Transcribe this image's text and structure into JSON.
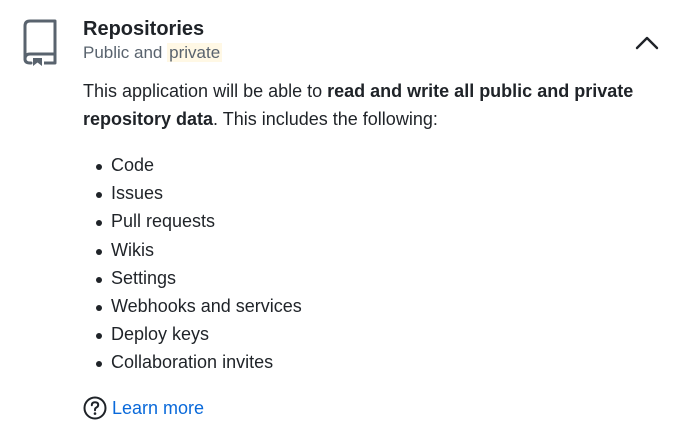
{
  "section": {
    "title": "Repositories",
    "subtitle_prefix": "Public and ",
    "subtitle_highlight": "private",
    "collapse_icon": "chevron-up-icon",
    "repo_icon": "repo-book-icon"
  },
  "description": {
    "intro": "This application will be able to ",
    "bold": "read and write all public and private repository data",
    "outro": ". This includes the following:"
  },
  "permissions": [
    "Code",
    "Issues",
    "Pull requests",
    "Wikis",
    "Settings",
    "Webhooks and services",
    "Deploy keys",
    "Collaboration invites"
  ],
  "learn_more": {
    "label": "Learn more",
    "icon": "question-circle-icon"
  },
  "colors": {
    "text": "#1f2328",
    "muted": "#59636e",
    "link": "#0969da",
    "highlight": "#fff8e5"
  }
}
